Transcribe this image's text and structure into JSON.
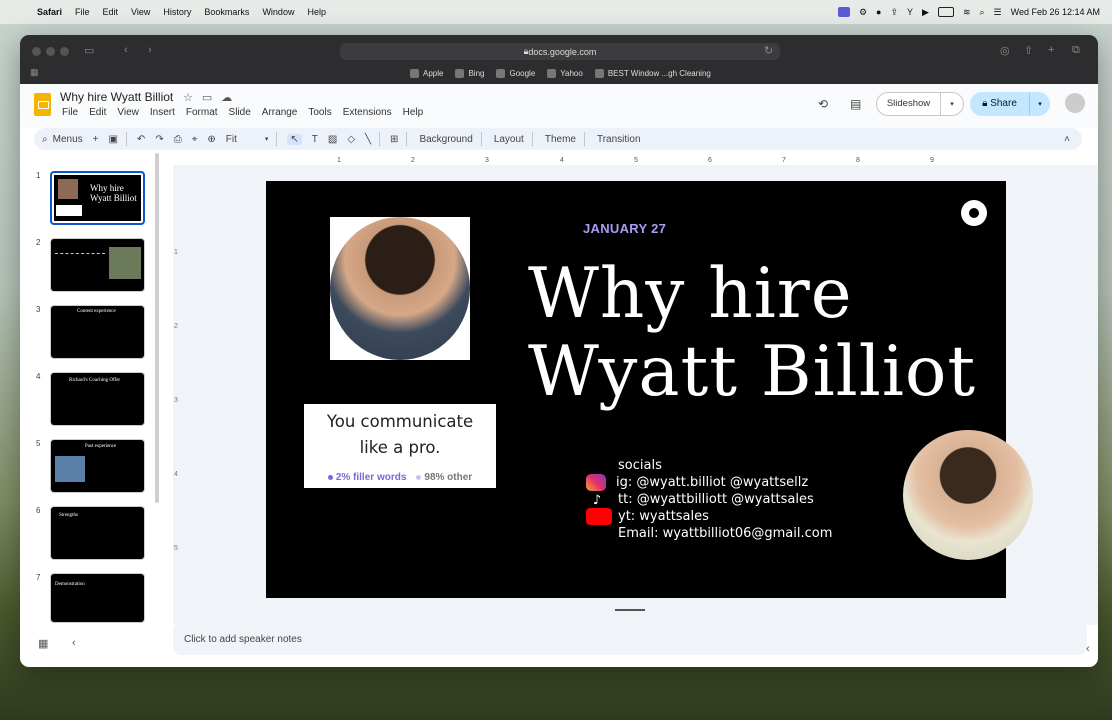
{
  "macos_menubar": {
    "app": "Safari",
    "items": [
      "File",
      "Edit",
      "View",
      "History",
      "Bookmarks",
      "Window",
      "Help"
    ],
    "datetime": "Wed Feb 26  12:14 AM"
  },
  "browser": {
    "url": "docs.google.com",
    "favorites": [
      "Apple",
      "Bing",
      "Google",
      "Yahoo",
      "BEST Window ...gh Cleaning"
    ]
  },
  "doc": {
    "title": "Why hire Wyatt Billiot",
    "menus": [
      "File",
      "Edit",
      "View",
      "Insert",
      "Format",
      "Slide",
      "Arrange",
      "Tools",
      "Extensions",
      "Help"
    ],
    "slideshow_label": "Slideshow",
    "share_label": "Share"
  },
  "toolbar": {
    "search_label": "Menus",
    "zoom": "Fit",
    "text_buttons": [
      "Background",
      "Layout",
      "Theme",
      "Transition"
    ]
  },
  "filmstrip": {
    "slides": [
      {
        "num": "1",
        "title": "Why hire Wyatt Billiot"
      },
      {
        "num": "2",
        "title": ""
      },
      {
        "num": "3",
        "title": "Content experience"
      },
      {
        "num": "4",
        "title": "Richard's Coaching Offer"
      },
      {
        "num": "5",
        "title": "Past experience"
      },
      {
        "num": "6",
        "title": "Strengths"
      },
      {
        "num": "7",
        "title": "Demonstration"
      }
    ]
  },
  "ruler": {
    "h_ticks": [
      "1",
      "2",
      "3",
      "4",
      "5",
      "6",
      "7",
      "8",
      "9"
    ],
    "v_ticks": [
      "1",
      "2",
      "3",
      "4",
      "5"
    ]
  },
  "slide": {
    "date": "JANUARY 27",
    "title_line1": "Why hire",
    "title_line2": "Wyatt Billiot",
    "card_line1": "You communicate",
    "card_line2": "like a pro.",
    "stat_a": "2% filler words",
    "stat_b": "98% other",
    "socials": {
      "heading": "socials",
      "ig": "ig: @wyatt.billiot @wyattsellz",
      "tt": "tt: @wyattbilliott @wyattsales",
      "yt": "yt: wyattsales",
      "email": "Email: wyattbilliot06@gmail.com"
    }
  },
  "notes_placeholder": "Click to add speaker notes",
  "colors": {
    "accent": "#0b57d0",
    "share_bg": "#c2e7ff",
    "date_purple": "#a99cf2",
    "logo": "#f4b400"
  }
}
